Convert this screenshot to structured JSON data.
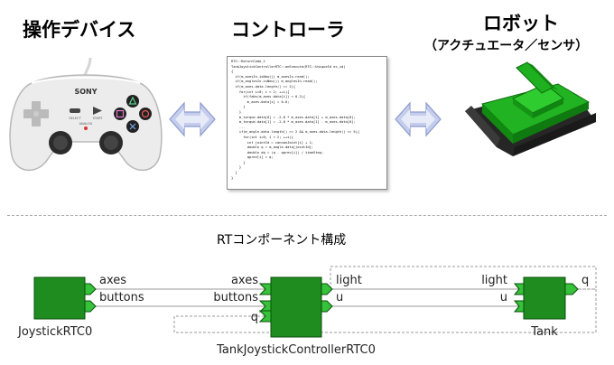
{
  "headings": {
    "controller": "操作デバイス",
    "logic": "コントローラ",
    "robot": "ロボット",
    "robot_sub": "（アクチュエータ／センサ）"
  },
  "gamepad": {
    "brand": "SONY",
    "select": "SELECT",
    "start": "START",
    "analog": "ANALOG"
  },
  "code_lines": [
    "RTC::ReturnCode_t",
    "TankJoystickControllerRTC::onExecute(RTC::UniqueId ec_id)",
    "{",
    "  if(m_axesIn.isNew()) m_axesIn.read();",
    "  if(m_anglesIn.isNew()) m_anglesIn.read();",
    "  if(m_axes.data.length() >= 2){",
    "    for(int i=0; i < 2; ++i){",
    "      if(fabs(m_axes.data[i]) < 0.2){",
    "        m_axes.data[i] = 0.0;",
    "      }",
    "    }",
    "    m_torque.data[0] = -2.0 * m_axes.data[1] + m_axes.data[0];",
    "    m_torque.data[1] = -2.0 * m_axes.data[1] - m_axes.data[0];",
    "    ...",
    "    if(m_angle.data.length() >= 2 && m_axes.data.length() >= 5){",
    "      for(int i=0; i < 2; ++i){",
    "        int jointId = cannonJoint[i] + 1;",
    "        double q = m_angle.data[jointId];",
    "        double dq = (q - qprev[i]) / timeStep;",
    "        qprev[i] = q;",
    "      }",
    "    }",
    "  }",
    "}"
  ],
  "section_title": "RTコンポーネント構成",
  "components": {
    "joystick": {
      "name": "JoystickRTC0",
      "ports": [
        "axes",
        "buttons"
      ]
    },
    "controller": {
      "name": "TankJoystickControllerRTC0",
      "in_ports": [
        "axes",
        "buttons",
        "q"
      ],
      "out_ports": [
        "light",
        "u"
      ]
    },
    "tank": {
      "name": "Tank",
      "in_ports": [
        "light",
        "u"
      ],
      "out_ports": [
        "q"
      ]
    }
  },
  "colors": {
    "component": "#1e8c1e",
    "port": "#36c23a",
    "arrow": "#b9c5e8",
    "tank": "#21b321"
  },
  "icons": [
    "double-arrow-icon",
    "gamepad-icon",
    "tank-robot-icon"
  ]
}
